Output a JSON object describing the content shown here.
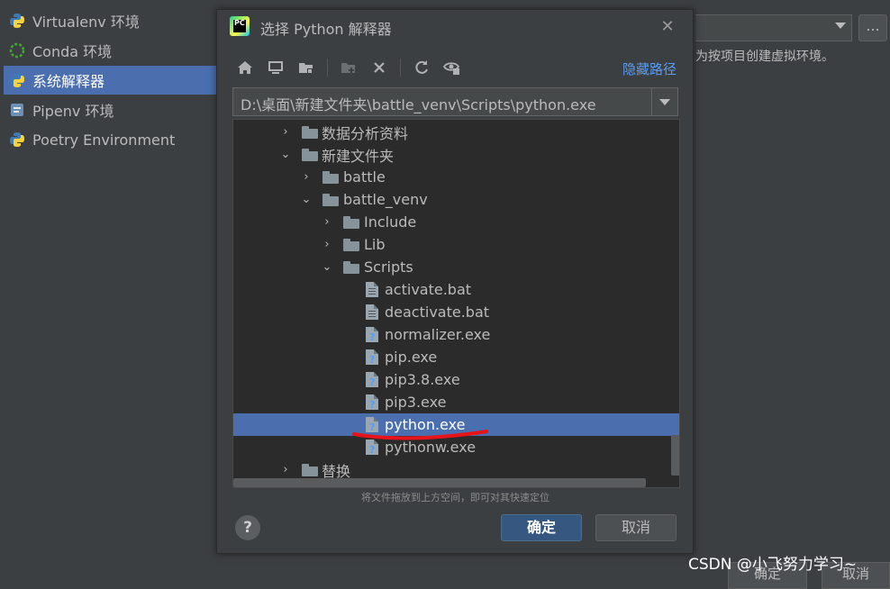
{
  "sidebar": {
    "items": [
      {
        "label": "Virtualenv 环境",
        "icon": "python-icon",
        "selected": false
      },
      {
        "label": "Conda 环境",
        "icon": "conda-icon",
        "selected": false
      },
      {
        "label": "系统解释器",
        "icon": "python-icon",
        "selected": true
      },
      {
        "label": "Pipenv 环境",
        "icon": "pipenv-icon",
        "selected": false
      },
      {
        "label": "Poetry Environment",
        "icon": "python-icon",
        "selected": false
      }
    ]
  },
  "background": {
    "hint": "为按项目创建虚拟环境。",
    "dots_label": "...",
    "ok_label": "确定",
    "cancel_label": "取消"
  },
  "dialog": {
    "title": "选择 Python 解释器",
    "logo_text": "PC",
    "hide_path_link": "隐藏路径",
    "path_value": "D:\\桌面\\新建文件夹\\battle_venv\\Scripts\\python.exe",
    "drag_hint": "将文件拖放到上方空间，即可对其快速定位",
    "help_label": "?",
    "ok_label": "确定",
    "cancel_label": "取消",
    "toolbar_icons": [
      "home-icon",
      "desktop-icon",
      "project-folder-icon",
      "new-folder-icon",
      "delete-icon",
      "refresh-icon",
      "show-hidden-icon"
    ],
    "tree": [
      {
        "label": "数据分析资料",
        "type": "folder",
        "expanded": false
      },
      {
        "label": "新建文件夹",
        "type": "folder",
        "expanded": true
      },
      {
        "label": "battle",
        "type": "folder",
        "expanded": false
      },
      {
        "label": "battle_venv",
        "type": "folder",
        "expanded": true
      },
      {
        "label": "Include",
        "type": "folder",
        "expanded": false
      },
      {
        "label": "Lib",
        "type": "folder",
        "expanded": false
      },
      {
        "label": "Scripts",
        "type": "folder",
        "expanded": true
      },
      {
        "label": "activate.bat",
        "type": "text-file"
      },
      {
        "label": "deactivate.bat",
        "type": "text-file"
      },
      {
        "label": "normalizer.exe",
        "type": "exe-file"
      },
      {
        "label": "pip.exe",
        "type": "exe-file"
      },
      {
        "label": "pip3.8.exe",
        "type": "exe-file"
      },
      {
        "label": "pip3.exe",
        "type": "exe-file"
      },
      {
        "label": "python.exe",
        "type": "exe-file",
        "selected": true
      },
      {
        "label": "pythonw.exe",
        "type": "exe-file"
      },
      {
        "label": "替换",
        "type": "folder",
        "expanded": false
      }
    ]
  },
  "watermark": "CSDN @小飞努力学习~",
  "colors": {
    "background": "#3c3f41",
    "tree_background": "#2b2b2b",
    "selection": "#4b6eaf",
    "link": "#589df6",
    "primary_button": "#365880",
    "annotation_red": "#e8141b"
  }
}
